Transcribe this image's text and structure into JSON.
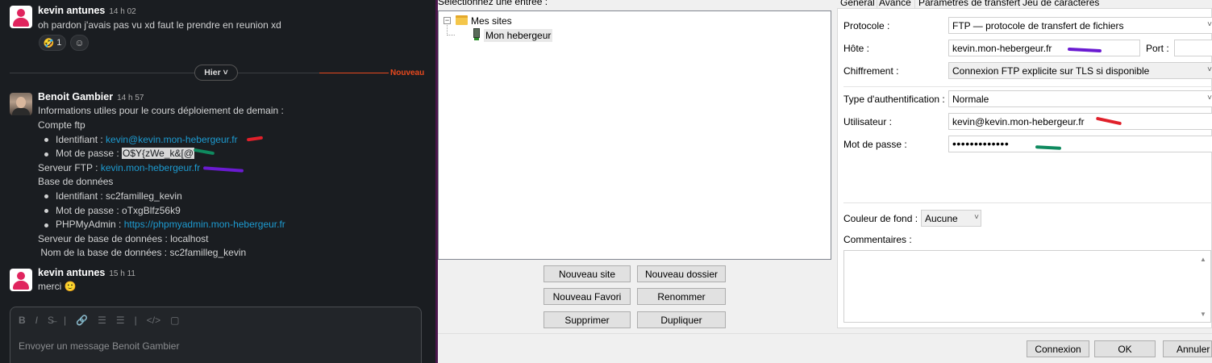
{
  "chat": {
    "msg1": {
      "author": "kevin antunes",
      "time": "14 h 02",
      "text": "oh pardon j'avais pas vu xd faut le prendre en reunion xd",
      "reaction_emoji": "🤣",
      "reaction_count": "1"
    },
    "divider": {
      "label": "Hier ˅",
      "new_label": "Nouveau"
    },
    "msg2": {
      "author": "Benoit Gambier",
      "time": "14 h 57",
      "line1": "Informations utiles pour le cours déploiement de demain :",
      "line2": "Compte ftp",
      "ftp_id_label": "Identifiant : ",
      "ftp_id_value": "kevin@kevin.mon-hebergeur.fr",
      "ftp_pw_label": "Mot de passe : ",
      "ftp_pw_value": "O$Y{zWe_k&[@",
      "ftp_server_label": "Serveur FTP : ",
      "ftp_server_value": "kevin.mon-hebergeur.fr",
      "db_title": "Base de données",
      "db_id": "Identifiant : sc2familleg_kevin",
      "db_pw": "Mot de passe : oTxgBlfz56k9",
      "pma_label": "PHPMyAdmin : ",
      "pma_value": "https://phpmyadmin.mon-hebergeur.fr",
      "db_server": "Serveur de base de données : localhost",
      "db_name": " Nom de la base de données : sc2familleg_kevin"
    },
    "msg3": {
      "author": "kevin antunes",
      "time": "15 h 11",
      "text": "merci",
      "emoji": "🙂"
    },
    "composer": {
      "placeholder": "Envoyer un message Benoit Gambier",
      "tools": [
        "B",
        "I",
        "S̶",
        "|",
        "🔗",
        "☰",
        "☰",
        "|",
        "</>",
        "▢"
      ]
    }
  },
  "filezilla": {
    "tree_caption": "Sélectionnez une entrée :",
    "tree_root": "Mes sites",
    "tree_child": "Mon hebergeur",
    "buttons": {
      "new_site": "Nouveau site",
      "new_folder": "Nouveau dossier",
      "new_bookmark": "Nouveau Favori",
      "rename": "Renommer",
      "delete": "Supprimer",
      "duplicate": "Dupliquer"
    },
    "tabs": [
      "Général",
      "Avancé",
      "Paramètres de transfert",
      "Jeu de caractères"
    ],
    "form": {
      "protocol_label": "Protocole :",
      "protocol_value": "FTP — protocole de transfert de fichiers",
      "host_label": "Hôte :",
      "host_value": "kevin.mon-hebergeur.fr",
      "port_label": "Port :",
      "port_value": "",
      "encryption_label": "Chiffrement :",
      "encryption_value": "Connexion FTP explicite sur TLS si disponible",
      "auth_label": "Type d'authentification :",
      "auth_value": "Normale",
      "user_label": "Utilisateur :",
      "user_value": "kevin@kevin.mon-hebergeur.fr",
      "password_label": "Mot de passe :",
      "password_value": "•••••••••••••",
      "bg_color_label": "Couleur de fond :",
      "bg_color_value": "Aucune",
      "comments_label": "Commentaires :",
      "comments_value": ""
    },
    "footer": {
      "connect": "Connexion",
      "ok": "OK",
      "cancel": "Annuler"
    }
  },
  "colors": {
    "slack_bg": "#1a1d21",
    "link": "#1d9bd1",
    "new_divider": "#e8491e",
    "scribble_red": "#e0202a",
    "scribble_green": "#0f8a5f",
    "scribble_purple": "#6a1bd1"
  }
}
